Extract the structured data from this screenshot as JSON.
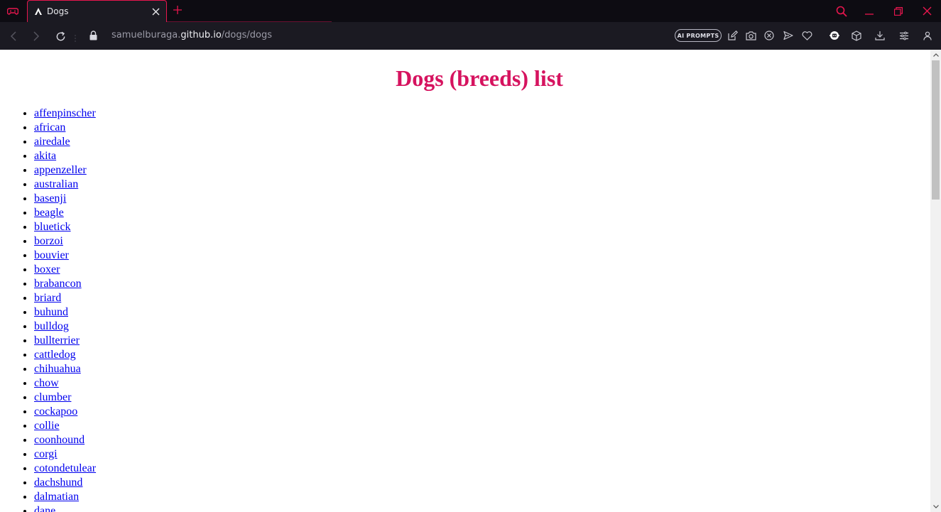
{
  "browser": {
    "tab": {
      "title": "Dogs"
    },
    "address": {
      "host_prefix": "samuelburaga.",
      "host_main": "github.io",
      "path": "/dogs/dogs"
    },
    "ai_prompts_label": "AI PROMPTS",
    "accent_color": "#e8164e"
  },
  "page": {
    "title": "Dogs (breeds) list",
    "title_color": "#d6135f",
    "breeds": [
      "affenpinscher",
      "african",
      "airedale",
      "akita",
      "appenzeller",
      "australian",
      "basenji",
      "beagle",
      "bluetick",
      "borzoi",
      "bouvier",
      "boxer",
      "brabancon",
      "briard",
      "buhund",
      "bulldog",
      "bullterrier",
      "cattledog",
      "chihuahua",
      "chow",
      "clumber",
      "cockapoo",
      "collie",
      "coonhound",
      "corgi",
      "cotondetulear",
      "dachshund",
      "dalmatian",
      "dane"
    ]
  },
  "icons": {
    "gx": "gx-corner-icon",
    "favicon": "opera-a-icon",
    "close": "close-icon",
    "new_tab": "plus-icon",
    "search": "search-icon",
    "minimize": "minimize-icon",
    "restore": "restore-icon",
    "window_close": "close-icon",
    "back": "chevron-left-icon",
    "forward": "chevron-right-icon",
    "reload": "reload-icon",
    "lock": "lock-icon",
    "edit": "edit-icon",
    "camera": "camera-icon",
    "block": "block-icon",
    "send": "send-icon",
    "heart": "heart-icon",
    "extension": "extension-icon",
    "box": "cube-icon",
    "download": "download-icon",
    "settings": "easy-setup-icon",
    "profile": "profile-icon"
  }
}
